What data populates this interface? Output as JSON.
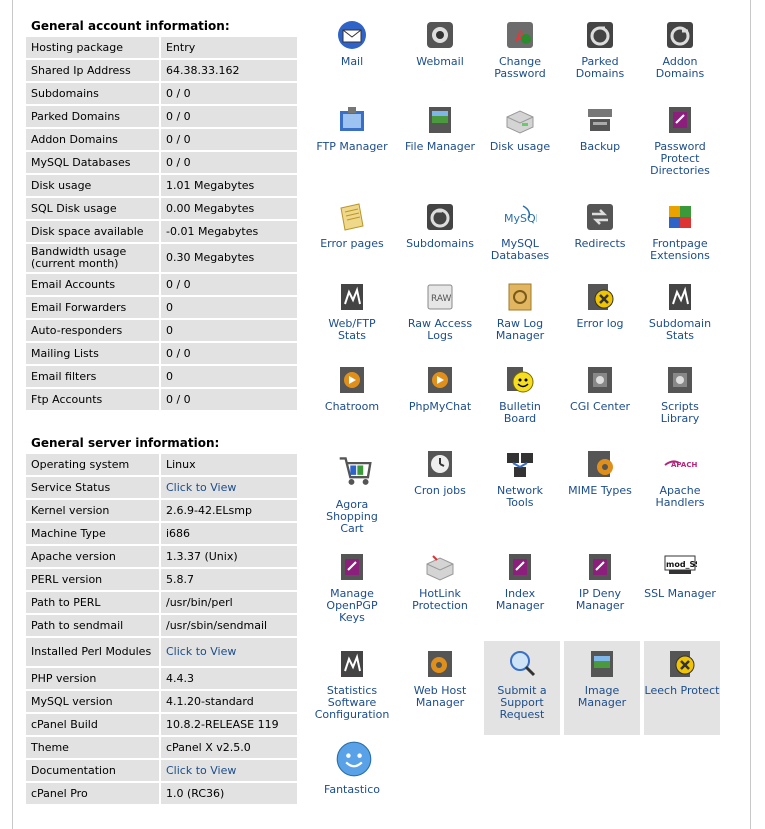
{
  "account": {
    "title": "General account information:",
    "rows": [
      {
        "label": "Hosting package",
        "value": "Entry"
      },
      {
        "label": "Shared Ip Address",
        "value": "64.38.33.162"
      },
      {
        "label": "Subdomains",
        "value": "0 / 0"
      },
      {
        "label": "Parked Domains",
        "value": "0 / 0"
      },
      {
        "label": "Addon Domains",
        "value": "0 / 0"
      },
      {
        "label": "MySQL Databases",
        "value": "0 / 0"
      },
      {
        "label": "Disk usage",
        "value": "1.01 Megabytes"
      },
      {
        "label": "SQL Disk usage",
        "value": "0.00 Megabytes"
      },
      {
        "label": "Disk space available",
        "value": "-0.01 Megabytes"
      },
      {
        "label": "Bandwidth usage (current month)",
        "value": "0.30 Megabytes"
      },
      {
        "label": "Email Accounts",
        "value": "0 / 0"
      },
      {
        "label": "Email Forwarders",
        "value": "0"
      },
      {
        "label": "Auto-responders",
        "value": "0"
      },
      {
        "label": "Mailing Lists",
        "value": "0 / 0"
      },
      {
        "label": "Email filters",
        "value": "0"
      },
      {
        "label": "Ftp Accounts",
        "value": "0 / 0"
      }
    ]
  },
  "server": {
    "title": "General server information:",
    "rows": [
      {
        "label": "Operating system",
        "value": "Linux"
      },
      {
        "label": "Service Status",
        "value": "Click to View"
      },
      {
        "label": "Kernel version",
        "value": "2.6.9-42.ELsmp"
      },
      {
        "label": "Machine Type",
        "value": "i686"
      },
      {
        "label": "Apache version",
        "value": "1.3.37 (Unix)"
      },
      {
        "label": "PERL version",
        "value": "5.8.7"
      },
      {
        "label": "Path to PERL",
        "value": "/usr/bin/perl"
      },
      {
        "label": "Path to sendmail",
        "value": "/usr/sbin/sendmail"
      },
      {
        "label": "Installed Perl Modules",
        "value": "Click to View"
      },
      {
        "label": "PHP version",
        "value": "4.4.3"
      },
      {
        "label": "MySQL version",
        "value": "4.1.20-standard"
      },
      {
        "label": "cPanel Build",
        "value": "10.8.2-RELEASE 119"
      },
      {
        "label": "Theme",
        "value": "cPanel X v2.5.0"
      },
      {
        "label": "Documentation",
        "value": "Click to View"
      },
      {
        "label": "cPanel Pro",
        "value": "1.0 (RC36)"
      }
    ]
  },
  "icons": {
    "mail": "Mail",
    "webmail": "Webmail",
    "change_password": "Change Password",
    "parked_domains": "Parked Domains",
    "addon_domains": "Addon Domains",
    "ftp_manager": "FTP Manager",
    "file_manager": "File Manager",
    "disk_usage": "Disk usage",
    "backup": "Backup",
    "password_protect": "Password Protect Directories",
    "error_pages": "Error pages",
    "subdomains": "Subdomains",
    "mysql_databases": "MySQL Databases",
    "redirects": "Redirects",
    "frontpage": "Frontpage Extensions",
    "webftp_stats": "Web/FTP Stats",
    "raw_access": "Raw Access Logs",
    "raw_log_manager": "Raw Log Manager",
    "error_log": "Error log",
    "subdomain_stats": "Subdomain Stats",
    "chatroom": "Chatroom",
    "phpmychat": "PhpMyChat",
    "bulletin_board": "Bulletin Board",
    "cgi_center": "CGI Center",
    "scripts_library": "Scripts Library",
    "agora": "Agora Shopping Cart",
    "cron_jobs": "Cron jobs",
    "network_tools": "Network Tools",
    "mime_types": "MIME Types",
    "apache_handlers": "Apache Handlers",
    "openpgp": "Manage OpenPGP Keys",
    "hotlink": "HotLink Protection",
    "index_manager": "Index Manager",
    "ip_deny": "IP Deny Manager",
    "ssl_manager": "SSL Manager",
    "statistics_config": "Statistics Software Configuration",
    "web_host_manager": "Web Host Manager",
    "submit_support": "Submit a Support Request",
    "image_manager": "Image Manager",
    "leech_protect": "Leech Protect",
    "fantastico": "Fantastico",
    "icon_text": {
      "raw": "RAW",
      "mysql": "MySQL",
      "apache": "APACHE",
      "modssl": "mod_SSL"
    }
  }
}
